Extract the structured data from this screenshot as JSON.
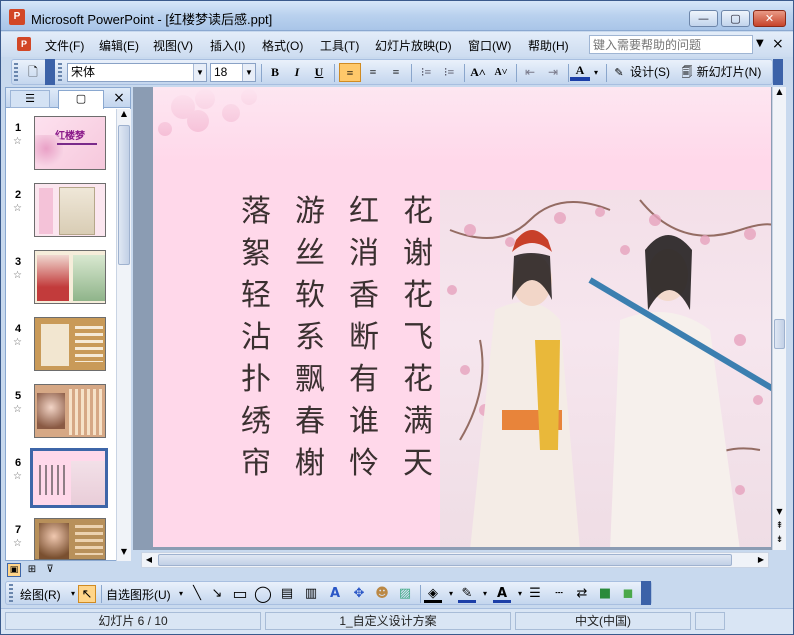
{
  "window": {
    "app_title": "Microsoft PowerPoint - [红楼梦读后感.ppt]",
    "app_icon": "P",
    "minimize_label": "—",
    "maximize_label": "▢",
    "close_label": "✕"
  },
  "menu": {
    "items": [
      "文件(F)",
      "编辑(E)",
      "视图(V)",
      "插入(I)",
      "格式(O)",
      "工具(T)",
      "幻灯片放映(D)",
      "窗口(W)",
      "帮助(H)"
    ],
    "help_placeholder": "键入需要帮助的问题",
    "help_arrow": "▼",
    "doc_close": "×"
  },
  "toolbar": {
    "font_name": "宋体",
    "font_size": "18",
    "bold": "B",
    "italic": "I",
    "underline": "U",
    "grow_font": "A˄",
    "shrink_font": "A˅",
    "font_color": "A",
    "design_label": "设计(S)",
    "new_slide_label": "新幻灯片(N)"
  },
  "slides_pane": {
    "tab_outline_icon": "outline-tab-icon",
    "tab_slides_icon": "slides-tab-icon",
    "close": "×",
    "items": [
      {
        "num": "1",
        "star": "☆",
        "caption": "红楼梦"
      },
      {
        "num": "2",
        "star": "☆"
      },
      {
        "num": "3",
        "star": "☆"
      },
      {
        "num": "4",
        "star": "☆"
      },
      {
        "num": "5",
        "star": "☆"
      },
      {
        "num": "6",
        "star": "☆"
      },
      {
        "num": "7",
        "star": "☆"
      }
    ],
    "selected": 6
  },
  "slide": {
    "poem_rows": [
      [
        "落",
        "游",
        "红",
        "花"
      ],
      [
        "絮",
        "丝",
        "消",
        "谢"
      ],
      [
        "轻",
        "软",
        "香",
        "花"
      ],
      [
        "沾",
        "系",
        "断",
        "飞"
      ],
      [
        "扑",
        "飘",
        "有",
        "花"
      ],
      [
        "绣",
        "春",
        "谁",
        "满"
      ],
      [
        "帘",
        "榭",
        "怜",
        "天"
      ]
    ],
    "background_color": "#ffd8ea"
  },
  "drawing_toolbar": {
    "draw_label": "绘图(R)",
    "autoshapes_label": "自选图形(U)"
  },
  "status": {
    "slide_position": "幻灯片 6 / 10",
    "design_template": "1_自定义设计方案",
    "language": "中文(中国)"
  }
}
